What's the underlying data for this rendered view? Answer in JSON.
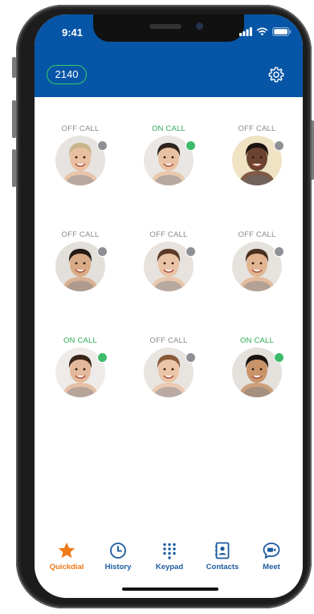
{
  "status_bar": {
    "time": "9:41"
  },
  "header": {
    "extension": "2140"
  },
  "contacts": [
    {
      "status": "OFF CALL",
      "state": "off",
      "skin": "#e8c0a0",
      "hair": "#c9b48a",
      "bg": "#e6e3e0"
    },
    {
      "status": "ON CALL",
      "state": "on",
      "skin": "#e9c2a3",
      "hair": "#2e241d",
      "bg": "#e9e6e3"
    },
    {
      "status": "OFF CALL",
      "state": "off",
      "skin": "#6b4330",
      "hair": "#1d1410",
      "bg": "#efe3c4"
    },
    {
      "status": "OFF CALL",
      "state": "off",
      "skin": "#d9aa86",
      "hair": "#241a14",
      "bg": "#e3dfdb"
    },
    {
      "status": "OFF CALL",
      "state": "off",
      "skin": "#e9c3a5",
      "hair": "#5a3a26",
      "bg": "#e7e2dd"
    },
    {
      "status": "OFF CALL",
      "state": "off",
      "skin": "#e2b592",
      "hair": "#4a2f1f",
      "bg": "#e6e2de"
    },
    {
      "status": "ON CALL",
      "state": "on",
      "skin": "#e4b89a",
      "hair": "#3a2418",
      "bg": "#eeebe8"
    },
    {
      "status": "OFF CALL",
      "state": "off",
      "skin": "#ebc6a8",
      "hair": "#8a5a38",
      "bg": "#e8e4e0"
    },
    {
      "status": "ON CALL",
      "state": "on",
      "skin": "#c9946a",
      "hair": "#1a1410",
      "bg": "#e4e1dd"
    }
  ],
  "tabs": [
    {
      "label": "Quickdial",
      "icon": "star-icon"
    },
    {
      "label": "History",
      "icon": "clock-icon"
    },
    {
      "label": "Keypad",
      "icon": "keypad-icon"
    },
    {
      "label": "Contacts",
      "icon": "address-book-icon"
    },
    {
      "label": "Meet",
      "icon": "video-chat-icon"
    }
  ],
  "colors": {
    "header_blue": "#0755a6",
    "on_call_green": "#2eaa55",
    "off_call_gray": "#8a8a8a",
    "active_tab_orange": "#f07a1a",
    "tab_blue": "#1b5a9e"
  }
}
